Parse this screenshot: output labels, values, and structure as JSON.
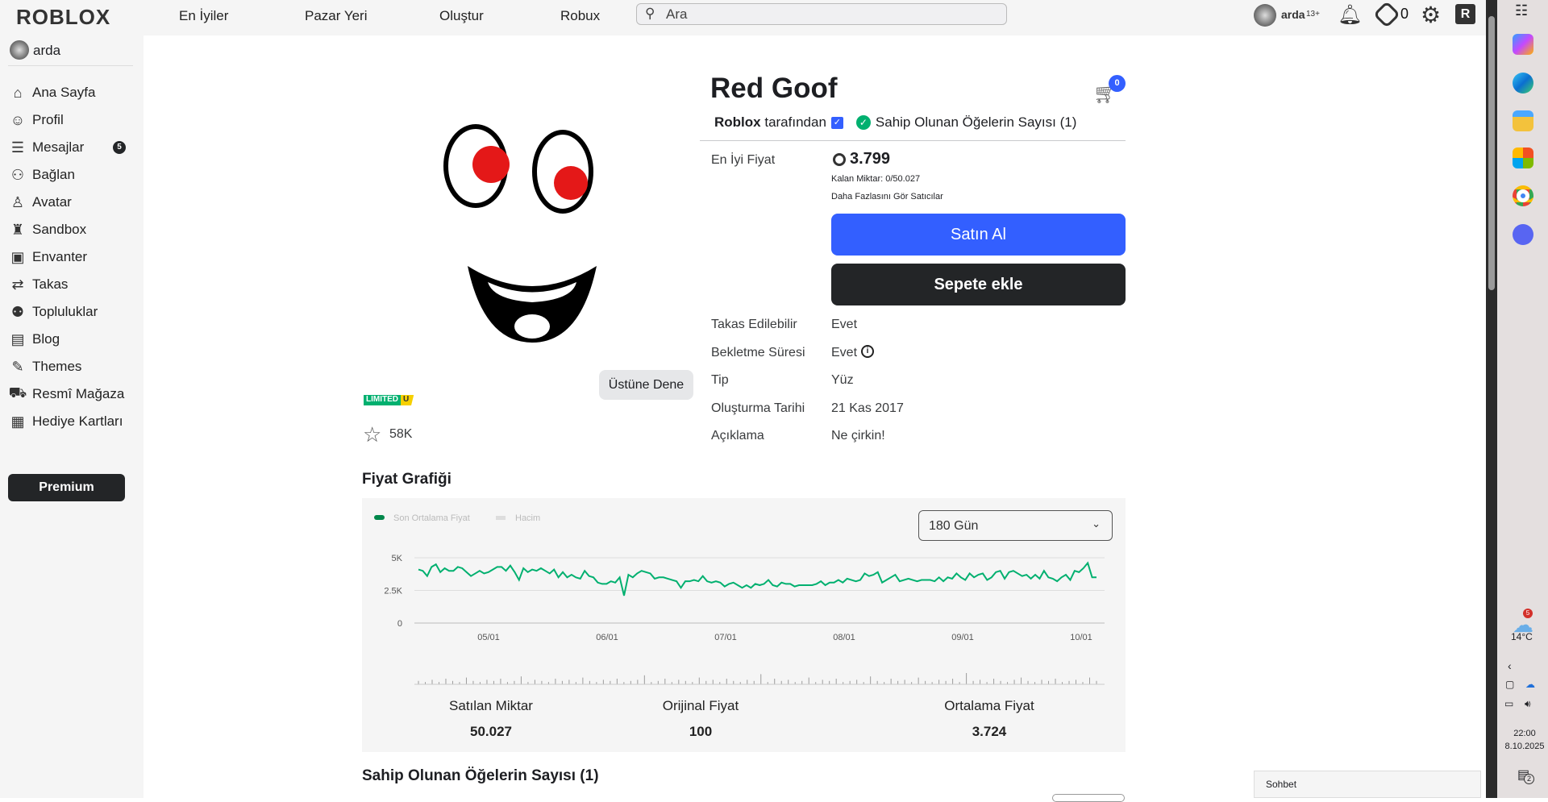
{
  "topbar": {
    "logo": "ROBLOX",
    "nav": [
      "En İyiler",
      "Pazar Yeri",
      "Oluştur",
      "Robux"
    ],
    "search_placeholder": "Ara",
    "username": "arda",
    "age_badge": "13+",
    "robux": "0"
  },
  "sidebar": {
    "username": "arda",
    "items": [
      {
        "label": "Ana Sayfa",
        "icon": "home-icon",
        "glyph": "⌂"
      },
      {
        "label": "Profil",
        "icon": "user-icon",
        "glyph": "☺"
      },
      {
        "label": "Mesajlar",
        "icon": "messages-icon",
        "glyph": "☰",
        "badge": "5"
      },
      {
        "label": "Bağlan",
        "icon": "friends-icon",
        "glyph": "⚇"
      },
      {
        "label": "Avatar",
        "icon": "avatar-icon",
        "glyph": "♙"
      },
      {
        "label": "Sandbox",
        "icon": "sandbox-icon",
        "glyph": "♜"
      },
      {
        "label": "Envanter",
        "icon": "inventory-icon",
        "glyph": "▣"
      },
      {
        "label": "Takas",
        "icon": "trade-icon",
        "glyph": "⇄"
      },
      {
        "label": "Topluluklar",
        "icon": "groups-icon",
        "glyph": "⚉"
      },
      {
        "label": "Blog",
        "icon": "blog-icon",
        "glyph": "▤"
      },
      {
        "label": "Themes",
        "icon": "themes-icon",
        "glyph": "✎"
      },
      {
        "label": "Resmî Mağaza",
        "icon": "store-icon",
        "glyph": "⛟"
      },
      {
        "label": "Hediye Kartları",
        "icon": "gift-card-icon",
        "glyph": "▦"
      }
    ],
    "premium": "Premium"
  },
  "item": {
    "title": "Red Goof",
    "creator": "Roblox",
    "creator_suffix": "tarafından",
    "owned": "Sahip Olunan Öğelerin Sayısı (1)",
    "cart_count": "0",
    "best_price_label": "En İyi Fiyat",
    "best_price": "3.799",
    "remaining": "Kalan Miktar: 0/50.027",
    "more_sellers": "Daha Fazlasını Gör Satıcılar",
    "buy": "Satın Al",
    "add_cart": "Sepete ekle",
    "try_on": "Üstüne Dene",
    "limited": "LIMITED",
    "limited_u": "U",
    "favorites": "58K",
    "details": [
      {
        "label": "Takas Edilebilir",
        "value": "Evet"
      },
      {
        "label": "Bekletme Süresi",
        "value": "Evet"
      },
      {
        "label": "Tip",
        "value": "Yüz"
      },
      {
        "label": "Oluşturma Tarihi",
        "value": "21 Kas 2017"
      },
      {
        "label": "Açıklama",
        "value": "Ne çirkin!"
      }
    ]
  },
  "chart_section": {
    "title": "Fiyat Grafiği",
    "range": "180 Gün",
    "stats": [
      {
        "label": "Satılan Miktar",
        "value": "50.027"
      },
      {
        "label": "Orijinal Fiyat",
        "value": "100"
      },
      {
        "label": "Ortalama Fiyat",
        "value": "3.724"
      }
    ]
  },
  "chart_data": {
    "type": "line",
    "title": "Fiyat Grafiği",
    "legend": [
      "Son Ortalama Fiyat",
      "Hacim"
    ],
    "legend_placement": "top-left",
    "ylabels": [
      "5K",
      "2.5K",
      "0"
    ],
    "ylim": [
      0,
      5000
    ],
    "xlabels": [
      "05/01",
      "06/01",
      "07/01",
      "08/01",
      "09/01",
      "10/01"
    ],
    "colors": {
      "price": "#00b06f",
      "volume": "#9b9b9b"
    },
    "price_k": [
      4.1,
      4.0,
      3.6,
      4.3,
      4.5,
      3.9,
      4.2,
      4.0,
      4.0,
      4.3,
      4.2,
      3.9,
      3.6,
      3.8,
      4.0,
      3.8,
      3.9,
      4.1,
      4.3,
      4.3,
      4.0,
      4.4,
      3.9,
      3.3,
      4.2,
      3.9,
      4.1,
      4.0,
      4.2,
      4.0,
      3.8,
      4.1,
      3.5,
      3.9,
      3.5,
      3.7,
      3.5,
      3.4,
      4.0,
      3.6,
      3.5,
      3.1,
      3.0,
      3.0,
      3.2,
      3.1,
      3.5,
      2.1,
      3.7,
      3.5,
      3.8,
      4.0,
      3.9,
      3.8,
      3.4,
      3.5,
      3.5,
      3.4,
      3.3,
      3.2,
      2.7,
      3.2,
      3.2,
      3.3,
      3.2,
      3.6,
      3.2,
      3.1,
      3.2,
      3.1,
      2.8,
      3.0,
      3.1,
      2.9,
      2.7,
      2.9,
      2.7,
      3.0,
      2.9,
      3.0,
      3.3,
      2.9,
      2.8,
      3.1,
      3.0,
      3.0,
      2.8,
      2.9,
      2.9,
      2.9,
      2.9,
      3.0,
      3.2,
      2.9,
      3.1,
      3.1,
      3.3,
      3.1,
      3.4,
      3.3,
      3.2,
      3.3,
      3.8,
      3.6,
      3.7,
      3.9,
      3.1,
      3.3,
      3.5,
      3.7,
      3.2,
      3.3,
      3.4,
      3.3,
      3.2,
      3.3,
      3.3,
      3.3,
      3.2,
      3.5,
      3.2,
      3.5,
      3.4,
      3.8,
      3.5,
      3.3,
      3.8,
      3.5,
      3.7,
      3.8,
      3.3,
      3.5,
      3.9,
      4.0,
      3.4,
      3.9,
      4.0,
      3.8,
      3.6,
      3.7,
      3.4,
      3.7,
      3.4,
      4.0,
      3.5,
      3.4,
      3.2,
      3.5,
      3.7,
      3.3,
      4.0,
      3.9,
      4.2,
      4.6,
      3.5,
      3.5
    ],
    "volume_rel": [
      3,
      2,
      4,
      2,
      5,
      3,
      2,
      6,
      3,
      2,
      4,
      3,
      5,
      2,
      3,
      7,
      2,
      4,
      3,
      2,
      5,
      3,
      4,
      2,
      6,
      3,
      2,
      4,
      3,
      5,
      2,
      3,
      4,
      8,
      2,
      3,
      5,
      2,
      4,
      3,
      2,
      6,
      3,
      4,
      2,
      5,
      3,
      2,
      4,
      3,
      9,
      2,
      5,
      3,
      4,
      2,
      3,
      6,
      2,
      4,
      3,
      5,
      2,
      3,
      4,
      2,
      7,
      3,
      2,
      5,
      3,
      4,
      2,
      6,
      3,
      2,
      4,
      3,
      5,
      2,
      10,
      3,
      4,
      2,
      5,
      3,
      2,
      4,
      6,
      3,
      2,
      4,
      3,
      5,
      2,
      3,
      4,
      2,
      6,
      3
    ]
  },
  "owned_section": {
    "title": "Sahip Olunan Öğelerin Sayısı (1)"
  },
  "chat": {
    "label": "Sohbet"
  },
  "taskbar": {
    "temp": "14°C",
    "weather_badge": "5",
    "time": "22:00",
    "date": "8.10.2025",
    "notif_count": "2"
  }
}
